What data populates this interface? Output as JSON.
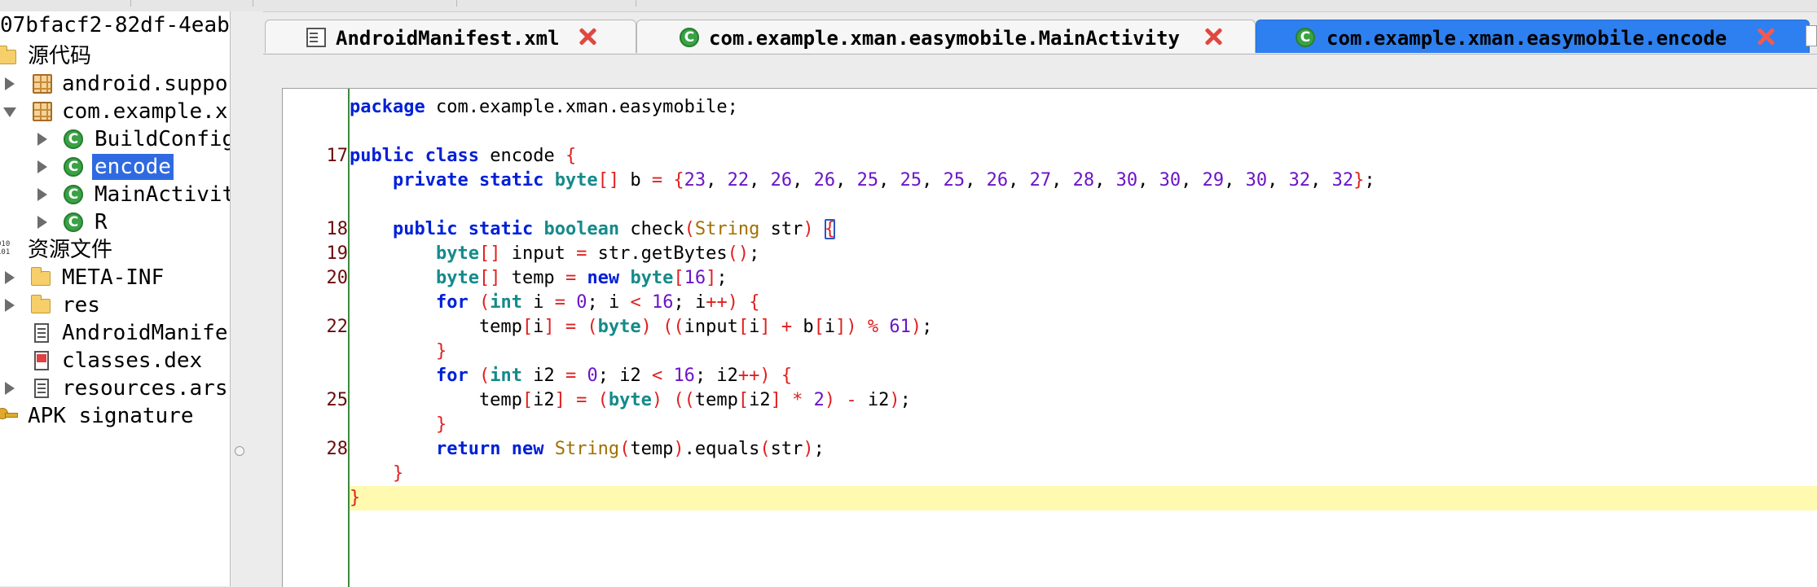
{
  "tree": {
    "root_label": "07bfacf2-82df-4eab",
    "items": [
      {
        "label": "源代码",
        "icon": "folder-open-icon"
      },
      {
        "label": "android.suppo",
        "icon": "package-icon"
      },
      {
        "label": "com.example.x",
        "icon": "package-icon"
      },
      {
        "label": "BuildConfig",
        "icon": "class-icon"
      },
      {
        "label": "encode",
        "icon": "class-icon"
      },
      {
        "label": "MainActivity",
        "icon": "class-icon"
      },
      {
        "label": "R",
        "icon": "class-icon"
      },
      {
        "label": "资源文件",
        "icon": "resources-icon"
      },
      {
        "label": "META-INF",
        "icon": "folder-icon"
      },
      {
        "label": "res",
        "icon": "folder-icon"
      },
      {
        "label": "AndroidManife",
        "icon": "file-icon"
      },
      {
        "label": "classes.dex",
        "icon": "dex-file-icon"
      },
      {
        "label": "resources.ars",
        "icon": "file-icon"
      },
      {
        "label": "APK signature",
        "icon": "key-icon"
      }
    ],
    "selected": "encode"
  },
  "tabs": [
    {
      "label": "AndroidManifest.xml",
      "icon": "file-icon",
      "active": false
    },
    {
      "label": "com.example.xman.easymobile.MainActivity",
      "icon": "class-icon",
      "active": false
    },
    {
      "label": "com.example.xman.easymobile.encode",
      "icon": "class-icon",
      "active": true
    }
  ],
  "editor": {
    "line_numbers": [
      "",
      "",
      "17",
      "",
      "",
      "18",
      "19",
      "20",
      "",
      "22",
      "",
      "",
      "25",
      "",
      "28",
      "",
      ""
    ],
    "lines": [
      "package com.example.xman.easymobile;",
      "",
      "public class encode {",
      "    private static byte[] b = {23, 22, 26, 26, 25, 25, 25, 26, 27, 28, 30, 30, 29, 30, 32, 32};",
      "",
      "    public static boolean check(String str) {",
      "        byte[] input = str.getBytes();",
      "        byte[] temp = new byte[16];",
      "        for (int i = 0; i < 16; i++) {",
      "            temp[i] = (byte) ((input[i] + b[i]) % 61);",
      "        }",
      "        for (int i2 = 0; i2 < 16; i2++) {",
      "            temp[i2] = (byte) ((temp[i2] * 2) - i2);",
      "        }",
      "        return new String(temp).equals(str);",
      "    }",
      "}"
    ],
    "highlighted_line": 16
  },
  "colors": {
    "keyword": "#0020d8",
    "type": "#158a8a",
    "number": "#6b14c8",
    "brace": "#e02020",
    "class_ref": "#a07000",
    "line_number": "#6b0c0c",
    "active_tab": "#2e80f0",
    "selection": "#2f6ae0",
    "current_line": "#fffaaf"
  }
}
